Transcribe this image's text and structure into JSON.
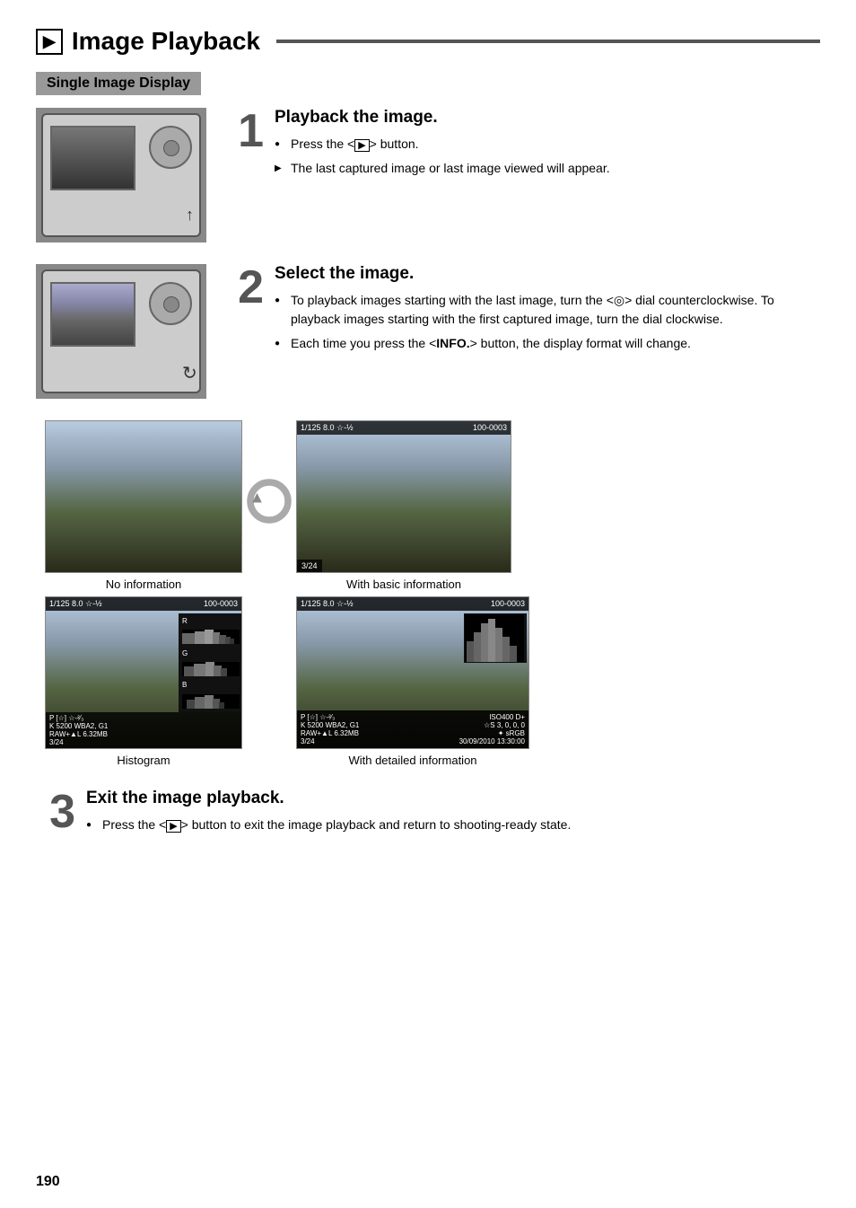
{
  "page": {
    "title": "Image Playback",
    "title_icon": "▶",
    "section_header": "Single Image Display",
    "page_number": "190"
  },
  "step1": {
    "number": "1",
    "title": "Playback the image.",
    "bullets": [
      {
        "type": "circle",
        "text": "Press the <▶> button."
      },
      {
        "type": "arrow",
        "text": "The last captured image or last image viewed will appear."
      }
    ]
  },
  "step2": {
    "number": "2",
    "title": "Select the image.",
    "bullets": [
      {
        "type": "circle",
        "text": "To playback images starting with the last image, turn the <○> dial counterclockwise. To playback images starting with the first captured image, turn the dial clockwise."
      },
      {
        "type": "circle",
        "text": "Each time you press the <INFO.> button, the display format will change."
      }
    ]
  },
  "step3": {
    "number": "3",
    "title": "Exit the image playback.",
    "bullets": [
      {
        "type": "circle",
        "text": "Press the <▶> button to exit the image playback and return to shooting-ready state."
      }
    ]
  },
  "panels": {
    "no_info_label": "No information",
    "basic_info_label": "With basic information",
    "histogram_label": "Histogram",
    "detailed_info_label": "With detailed information",
    "basic_overlay": {
      "top_left": "1/125   8.0  ☆-½",
      "top_right": "100-0003",
      "counter": "3/24"
    },
    "hist_overlay": {
      "top_left": "1/125   8.0  ☆-½",
      "top_right": "100-0003",
      "row1": "P  [☆] ☆-²⁄₃",
      "row2": "K 5200  WBA2, G1",
      "row3": "RAW+▲L  6.32MB",
      "row4": "3/24"
    },
    "detailed_overlay": {
      "top_left": "1/125   8.0  ☆-½",
      "top_right": "100-0003",
      "row1": "P  [☆] ☆-²⁄₃        ISO400  D+",
      "row2": "K 5200  WBA2, G1  ☆S 3,  0,  0,  0",
      "row3": "RAW+▲L  6.32MB    ✦ sRGB",
      "row4": "3/24              30/09/2010 13:30:00"
    }
  }
}
